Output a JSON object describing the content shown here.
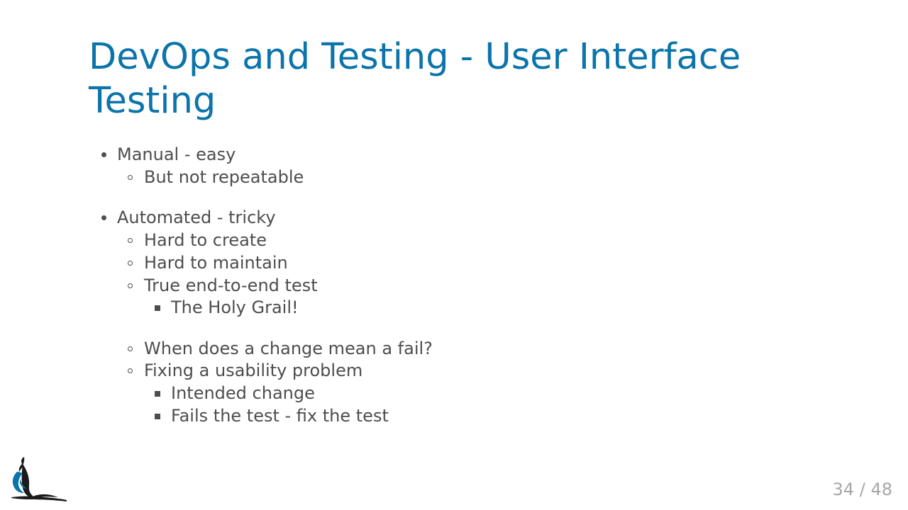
{
  "slide": {
    "title": "DevOps and Testing - User Interface Testing",
    "page_current": "34",
    "page_separator": "/",
    "page_total": "48"
  },
  "bullets": [
    {
      "level": 1,
      "text": "Manual - easy"
    },
    {
      "level": 2,
      "text": "But not repeatable"
    },
    {
      "level": 1,
      "text": "Automated - tricky"
    },
    {
      "level": 2,
      "text": "Hard to create"
    },
    {
      "level": 2,
      "text": "Hard to maintain"
    },
    {
      "level": 2,
      "text": "True end-to-end test"
    },
    {
      "level": 3,
      "text": "The Holy Grail!"
    },
    {
      "level": 2,
      "text": "When does a change mean a fail?"
    },
    {
      "level": 2,
      "text": "Fixing a usability problem"
    },
    {
      "level": 3,
      "text": "Intended change"
    },
    {
      "level": 3,
      "text": "Fails the test - fix the test"
    }
  ],
  "logo": {
    "icon": "bird-logo-icon",
    "colors": [
      "#1b1b1b",
      "#0b74aa"
    ]
  },
  "colors": {
    "title": "#0b74aa",
    "text": "#4d4d4d",
    "page_number": "#a6a6a6"
  }
}
